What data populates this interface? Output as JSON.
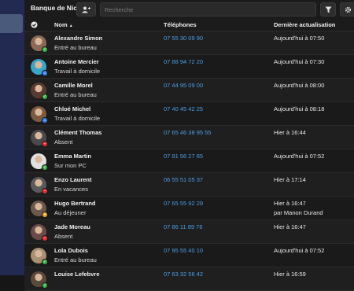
{
  "app": {
    "title": "Banque de Nice"
  },
  "search": {
    "placeholder": "Recherche"
  },
  "table": {
    "headers": {
      "name": "Nom",
      "phones": "Téléphones",
      "updated": "Dernière actualisation"
    },
    "rows": [
      {
        "name": "Alexandre Simon",
        "status": "Entré au bureau",
        "phone": "07 55 30 09 90",
        "updated": "Aujourd'hui à 07:50",
        "updated2": "",
        "badge": "green",
        "avatar_color": "#8a6a55"
      },
      {
        "name": "Antoine Mercier",
        "status": "Travail à domicile",
        "phone": "07 88 94 72 20",
        "updated": "Aujourd'hui à 07:30",
        "updated2": "",
        "badge": "blue",
        "avatar_color": "#3aa5c8"
      },
      {
        "name": "Camille Morel",
        "status": "Entré au bureau",
        "phone": "07 44 95 09 00",
        "updated": "Aujourd'hui à 08:00",
        "updated2": "",
        "badge": "green",
        "avatar_color": "#5a3a30"
      },
      {
        "name": "Chloé Michel",
        "status": "Travail à domicile",
        "phone": "07 40 45 42 25",
        "updated": "Aujourd'hui à 08:18",
        "updated2": "",
        "badge": "blue",
        "avatar_color": "#7a5a40"
      },
      {
        "name": "Clément Thomas",
        "status": "Absent",
        "phone": "07 65 46 38 95 55",
        "updated": "Hier à 16:44",
        "updated2": "",
        "badge": "red",
        "avatar_color": "#4a4a4a"
      },
      {
        "name": "Emma Martin",
        "status": "Sur mon PC",
        "phone": "07 81 56 27 85",
        "updated": "Aujourd'hui à 07:52",
        "updated2": "",
        "badge": "green",
        "avatar_color": "#e0e0e0"
      },
      {
        "name": "Enzo Laurent",
        "status": "En vacances",
        "phone": "06 55 51 05 37",
        "updated": "Hier à 17:14",
        "updated2": "",
        "badge": "red",
        "avatar_color": "#5a5a5a"
      },
      {
        "name": "Hugo Bertrand",
        "status": "Au déjeuner",
        "phone": "07 65 55 92 29",
        "updated": "Hier à 16:47",
        "updated2": "par Manon Durand",
        "badge": "orange",
        "avatar_color": "#6a5a4a"
      },
      {
        "name": "Jade Moreau",
        "status": "Absent",
        "phone": "07 86 11 89 76",
        "updated": "Hier à 16:47",
        "updated2": "",
        "badge": "red",
        "avatar_color": "#6a4a4a"
      },
      {
        "name": "Lola Dubois",
        "status": "Entré au bureau",
        "phone": "07 95 55 40 10",
        "updated": "Aujourd'hui à 07:52",
        "updated2": "",
        "badge": "green",
        "avatar_color": "#a89070"
      },
      {
        "name": "Louise Lefebvre",
        "status": "",
        "phone": "07 63 32 56 42",
        "updated": "Hier à 16:59",
        "updated2": "",
        "badge": "green",
        "avatar_color": "#5a4a3a"
      }
    ]
  },
  "colors": {
    "green": "#3cb043",
    "blue": "#2f80ed",
    "red": "#e03131",
    "orange": "#f2a33a",
    "accent": "#4a9de8"
  },
  "icons": {
    "add_user": "add-user-icon",
    "filter": "filter-icon",
    "settings": "gear-icon",
    "list": "list-icon",
    "select_all": "check-circle-icon",
    "sort": "sort-asc-icon"
  }
}
